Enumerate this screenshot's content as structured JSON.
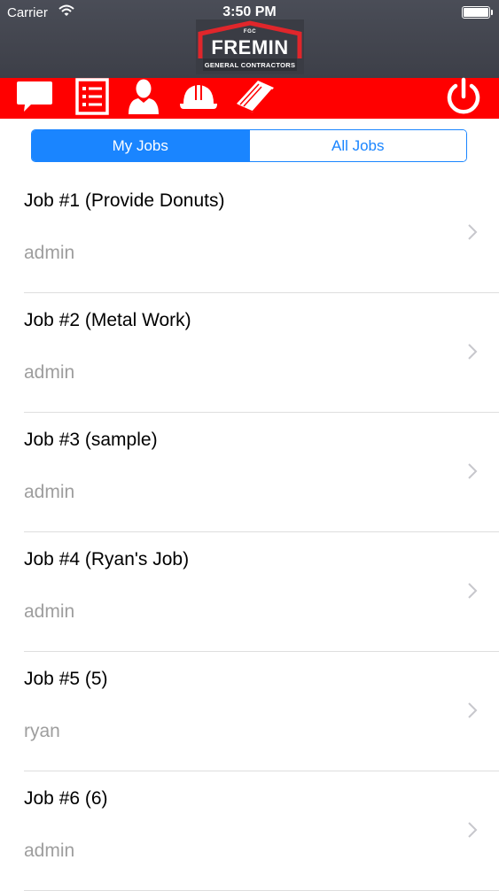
{
  "status_bar": {
    "carrier": "Carrier",
    "time": "3:50 PM"
  },
  "logo": {
    "initials": "FGC",
    "name": "FREMIN",
    "subtitle": "GENERAL CONTRACTORS"
  },
  "toolbar": {
    "icons": [
      "chat-bubble-icon",
      "checklist-icon",
      "user-icon",
      "hard-hat-icon",
      "book-icon",
      "power-icon"
    ],
    "accent_color": "#ff0000"
  },
  "segmented": {
    "options": [
      "My Jobs",
      "All Jobs"
    ],
    "selected": "My Jobs",
    "accent_color": "#1a85ff"
  },
  "jobs": [
    {
      "title": "Job #1 (Provide Donuts)",
      "owner": "admin"
    },
    {
      "title": "Job #2 (Metal Work)",
      "owner": "admin"
    },
    {
      "title": "Job #3 (sample)",
      "owner": "admin"
    },
    {
      "title": "Job #4 (Ryan's Job)",
      "owner": "admin"
    },
    {
      "title": "Job #5 (5)",
      "owner": "ryan"
    },
    {
      "title": "Job #6 (6)",
      "owner": "admin"
    }
  ]
}
